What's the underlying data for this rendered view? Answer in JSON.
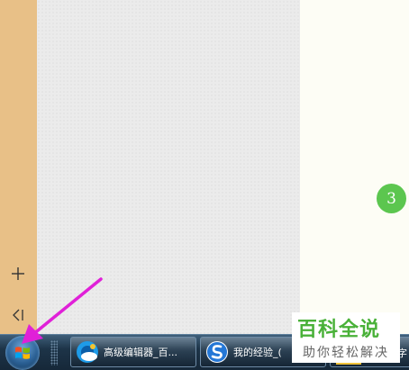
{
  "sidebar": {
    "add_label": "+",
    "collapse_label": "<|"
  },
  "step_badge": {
    "number": "3",
    "color": "#5cc64f"
  },
  "taskbar": {
    "start_icon": "windows-logo-icon",
    "items": [
      {
        "label": "高级编辑器_百...",
        "icon": "qq-browser-icon"
      },
      {
        "label": "我的经验_(",
        "icon": "sogou-browser-icon"
      },
      {
        "label": "字",
        "icon": "folder-icon"
      }
    ]
  },
  "watermark": {
    "title": "百科全说",
    "subtitle": "助你轻松解决"
  },
  "colors": {
    "sidebar": "#e8c087",
    "canvas": "#ebebeb",
    "right_panel": "#fdfdf5",
    "arrow": "#e020d8",
    "brand_green": "#49b138"
  }
}
